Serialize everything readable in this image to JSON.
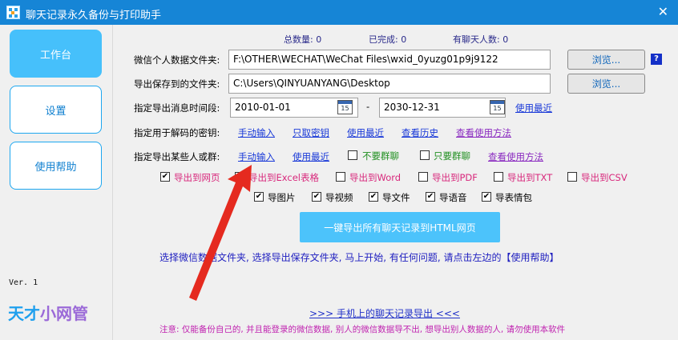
{
  "window": {
    "title": "聊天记录永久备份与打印助手",
    "close_symbol": "✕"
  },
  "sidebar": {
    "items": [
      {
        "label": "工作台"
      },
      {
        "label": "设置"
      },
      {
        "label": "使用帮助"
      }
    ],
    "version": "Ver. 1",
    "logo_part1": "天才",
    "logo_part2": "小网管"
  },
  "stats": {
    "total": "总数量: 0",
    "done": "已完成: 0",
    "contacts": "有聊天人数: 0"
  },
  "fields": {
    "wechat_label": "微信个人数据文件夹:",
    "wechat_value": "F:\\OTHER\\WECHAT\\WeChat Files\\wxid_0yuzg01p9j9122",
    "save_label": "导出保存到的文件夹:",
    "save_value": "C:\\Users\\QINYUANYANG\\Desktop",
    "browse_label": "浏览...",
    "help_q": "?",
    "date_label": "指定导出消息时间段:",
    "date_start": "2010-01-01",
    "date_sep": "-",
    "date_end": "2030-12-31",
    "cal_day": "15",
    "date_recent": "使用最近"
  },
  "key_row": {
    "label": "指定用于解码的密钥:",
    "manual": "手动输入",
    "fetch": "只取密钥",
    "recent": "使用最近",
    "history": "查看历史",
    "howto": "查看使用方法"
  },
  "target_row": {
    "label": "指定导出某些人或群:",
    "manual": "手动输入",
    "recent": "使用最近",
    "no_group": "不要群聊",
    "only_group": "只要群聊",
    "howto": "查看使用方法"
  },
  "export_formats": [
    {
      "label": "导出到网页",
      "checked": true
    },
    {
      "label": "导出到Excel表格",
      "checked": false
    },
    {
      "label": "导出到Word",
      "checked": false
    },
    {
      "label": "导出到PDF",
      "checked": false
    },
    {
      "label": "导出到TXT",
      "checked": false
    },
    {
      "label": "导出到CSV",
      "checked": false
    }
  ],
  "media_options": [
    {
      "label": "导图片",
      "checked": true
    },
    {
      "label": "导视频",
      "checked": true
    },
    {
      "label": "导文件",
      "checked": true
    },
    {
      "label": "导语音",
      "checked": true
    },
    {
      "label": "导表情包",
      "checked": true
    }
  ],
  "check_mark": "✔",
  "main_button": "一键导出所有聊天记录到HTML网页",
  "info_text": "选择微信数据文件夹, 选择导出保存文件夹, 马上开始, 有任何问题, 请点击左边的【使用帮助】",
  "footer_link": ">>>   手机上的聊天记录导出   <<<",
  "notice": "注意: 仅能备份自己的, 并且能登录的微信数据, 别人的微信数据导不出, 想导出别人数据的人, 请勿使用本软件",
  "colors": {
    "titlebar": "#1685d6",
    "accent": "#46c0fb",
    "arrow": "#e52a1f"
  }
}
